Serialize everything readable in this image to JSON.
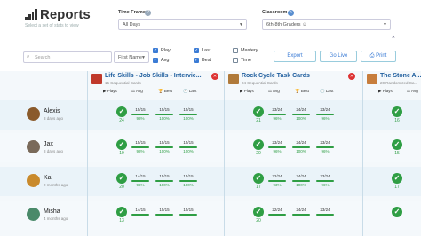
{
  "header": {
    "title": "Reports",
    "subtitle": "Select a set of stats to view"
  },
  "filters": {
    "time_frame_label": "Time Frame",
    "time_frame_value": "All Days",
    "classroom_label": "Classroom",
    "classroom_value": "6th-8th Graders ☺"
  },
  "toolbar": {
    "search_placeholder": "Search",
    "sort_value": "First Name",
    "checkboxes": [
      {
        "label": "Play",
        "checked": true
      },
      {
        "label": "Avg",
        "checked": true
      },
      {
        "label": "Last",
        "checked": true
      },
      {
        "label": "Best",
        "checked": true
      },
      {
        "label": "Mastery",
        "checked": false
      },
      {
        "label": "Time",
        "checked": false
      }
    ],
    "export_label": "Export",
    "go_live_label": "Go Live",
    "print_label": "Print"
  },
  "column_labels": {
    "plays": "Plays",
    "avg": "Avg",
    "best": "Best",
    "last": "Last"
  },
  "sets": [
    {
      "title": "Life Skills - Job Skills - Intervie...",
      "subtitle": "15 Sequential Cards",
      "thumb_color": "#c0392b"
    },
    {
      "title": "Rock Cycle Task Cards",
      "subtitle": "24 Sequential Cards",
      "thumb_color": "#b07a3a"
    },
    {
      "title": "The Stone A...",
      "subtitle": "20 Randomized Ca...",
      "thumb_color": "#c77d3c"
    }
  ],
  "students": [
    {
      "name": "Alexis",
      "time": "8 days ago",
      "avatar_color": "#8a5a2b",
      "sets": [
        {
          "plays": "24",
          "scores": [
            "15/15",
            "15/15",
            "15/15"
          ],
          "pcts": [
            "98%",
            "100%",
            "100%"
          ]
        },
        {
          "plays": "21",
          "scores": [
            "23/24",
            "24/24",
            "23/24"
          ],
          "pcts": [
            "96%",
            "100%",
            "96%"
          ]
        },
        {
          "plays": "16",
          "scores": [],
          "pcts": []
        }
      ]
    },
    {
      "name": "Jax",
      "time": "8 days ago",
      "avatar_color": "#7a6a5a",
      "sets": [
        {
          "plays": "19",
          "scores": [
            "15/15",
            "15/15",
            "15/15"
          ],
          "pcts": [
            "98%",
            "100%",
            "100%"
          ]
        },
        {
          "plays": "20",
          "scores": [
            "23/24",
            "24/24",
            "23/24"
          ],
          "pcts": [
            "96%",
            "100%",
            "96%"
          ]
        },
        {
          "plays": "15",
          "scores": [],
          "pcts": []
        }
      ]
    },
    {
      "name": "Kai",
      "time": "2 months ago",
      "avatar_color": "#c98a2c",
      "sets": [
        {
          "plays": "20",
          "scores": [
            "14/15",
            "15/15",
            "15/15"
          ],
          "pcts": [
            "96%",
            "100%",
            "100%"
          ]
        },
        {
          "plays": "17",
          "scores": [
            "22/24",
            "24/24",
            "23/24"
          ],
          "pcts": [
            "93%",
            "100%",
            "96%"
          ]
        },
        {
          "plays": "17",
          "scores": [],
          "pcts": []
        }
      ]
    },
    {
      "name": "Misha",
      "time": "4 months ago",
      "avatar_color": "#4a8a6a",
      "sets": [
        {
          "plays": "13",
          "scores": [
            "14/15",
            "15/15",
            "15/15"
          ],
          "pcts": [
            "",
            "",
            ""
          ]
        },
        {
          "plays": "20",
          "scores": [
            "22/24",
            "24/24",
            "23/24"
          ],
          "pcts": [
            "",
            "",
            ""
          ]
        },
        {
          "plays": "",
          "scores": [],
          "pcts": []
        }
      ]
    }
  ]
}
